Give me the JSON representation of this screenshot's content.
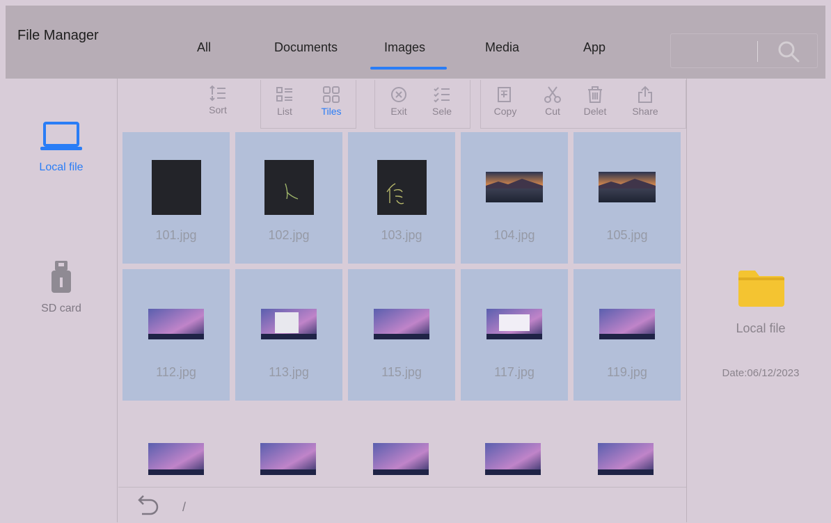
{
  "app": {
    "title": "File Manager"
  },
  "tabs": [
    {
      "label": "All",
      "active": false
    },
    {
      "label": "Documents",
      "active": false
    },
    {
      "label": "Images",
      "active": true
    },
    {
      "label": "Media",
      "active": false
    },
    {
      "label": "App",
      "active": false
    }
  ],
  "search": {
    "icon": "search-icon"
  },
  "sidebar": {
    "items": [
      {
        "label": "Local file",
        "icon": "laptop-icon",
        "active": true
      },
      {
        "label": "SD card",
        "icon": "sd-card-icon",
        "active": false
      }
    ]
  },
  "toolbar": {
    "sort": "Sort",
    "list": "List",
    "tiles": "Tiles",
    "exit": "Exit",
    "select": "Sele",
    "copy": "Copy",
    "cut": "Cut",
    "delete": "Delet",
    "share": "Share"
  },
  "files": [
    {
      "name": "101.jpg",
      "thumb": "blank-dark"
    },
    {
      "name": "102.jpg",
      "thumb": "handwriting-dark"
    },
    {
      "name": "103.jpg",
      "thumb": "handwriting-dark"
    },
    {
      "name": "104.jpg",
      "thumb": "sunset-lake"
    },
    {
      "name": "105.jpg",
      "thumb": "sunset-lake"
    },
    {
      "name": "112.jpg",
      "thumb": "desktop-screenshot"
    },
    {
      "name": "113.jpg",
      "thumb": "desktop-window"
    },
    {
      "name": "115.jpg",
      "thumb": "desktop-screenshot"
    },
    {
      "name": "117.jpg",
      "thumb": "desktop-dialog"
    },
    {
      "name": "119.jpg",
      "thumb": "desktop-screenshot"
    }
  ],
  "path": {
    "text": "/"
  },
  "details": {
    "name": "Local file",
    "date": "Date:06/12/2023"
  },
  "colors": {
    "accent": "#2a7df6",
    "tile_selected": "#b3bfd9",
    "folder": "#f4c431"
  }
}
